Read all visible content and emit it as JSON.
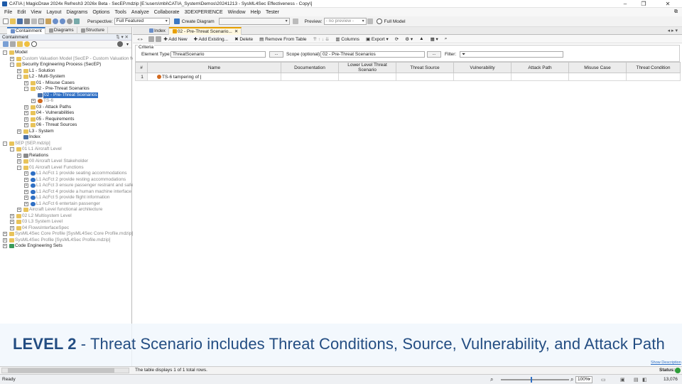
{
  "window": {
    "title": "CATIA | MagicDraw 2024x Refresh3 2026x Beta - SecEP.mdzip [E:\\users\\mbi\\CATIA_System\\Demos\\20241213 - SysML4Sec Effectiveness - Copy\\]"
  },
  "menu": [
    "File",
    "Edit",
    "View",
    "Layout",
    "Diagrams",
    "Options",
    "Tools",
    "Analyze",
    "Collaborate",
    "3DEXPERIENCE",
    "Window",
    "Help",
    "Tester"
  ],
  "toolbar": {
    "perspective_label": "Perspective:",
    "perspective_value": "Full Featured",
    "create_diagram": "Create Diagram",
    "preview_label": "Preview:",
    "preview_value": "- no preview -",
    "full_model": "Full Model"
  },
  "left_tabs": [
    "Containment",
    "Diagrams",
    "Structure"
  ],
  "containment_header": "Containment",
  "tree": [
    {
      "label": "Model",
      "indent": 0,
      "icon": "package",
      "toggle": "-"
    },
    {
      "label": "Custom Valuation Model [SecEP - Custom Valuation Mod",
      "indent": 1,
      "icon": "package",
      "toggle": "+",
      "gray": true
    },
    {
      "label": "Security Engineering Process (SecEP)",
      "indent": 1,
      "icon": "package",
      "toggle": "-"
    },
    {
      "label": "L1 - Solution",
      "indent": 2,
      "icon": "package",
      "toggle": "+"
    },
    {
      "label": "L2 - Multi-System",
      "indent": 2,
      "icon": "package",
      "toggle": "-"
    },
    {
      "label": "01 - Misuse Cases",
      "indent": 3,
      "icon": "package",
      "toggle": "+"
    },
    {
      "label": "02 - Pre-Threat Scenarios",
      "indent": 3,
      "icon": "package",
      "toggle": "-"
    },
    {
      "label": "02 - Pre-Threat Scenarios",
      "indent": 4,
      "icon": "table",
      "toggle": "",
      "selected": true
    },
    {
      "label": "TS-6",
      "indent": 4,
      "icon": "threat",
      "toggle": "+",
      "gray": true
    },
    {
      "label": "03 - Attack Paths",
      "indent": 3,
      "icon": "package",
      "toggle": "+"
    },
    {
      "label": "04 - Vulnerabilities",
      "indent": 3,
      "icon": "package",
      "toggle": "+"
    },
    {
      "label": "05 - Requirements",
      "indent": 3,
      "icon": "package",
      "toggle": "+"
    },
    {
      "label": "06 - Threat Sources",
      "indent": 3,
      "icon": "package",
      "toggle": "+"
    },
    {
      "label": "L3 - System",
      "indent": 2,
      "icon": "package",
      "toggle": "+"
    },
    {
      "label": "Index",
      "indent": 2,
      "icon": "table",
      "toggle": ""
    },
    {
      "label": "SEP [SEP.mdzip]",
      "indent": 0,
      "icon": "package",
      "toggle": "-",
      "gray": true
    },
    {
      "label": "01 L1 Aircraft Level",
      "indent": 1,
      "icon": "package",
      "toggle": "-",
      "gray": true
    },
    {
      "label": "Relations",
      "indent": 2,
      "icon": "relation",
      "toggle": "+"
    },
    {
      "label": "00 Aircraft Level Stakeholder",
      "indent": 2,
      "icon": "package",
      "toggle": "+",
      "gray": true
    },
    {
      "label": "01 Aircraft Level Functions",
      "indent": 2,
      "icon": "package",
      "toggle": "-",
      "gray": true
    },
    {
      "label": "L1 AcFct 1 provide seating accommodations",
      "indent": 3,
      "icon": "function",
      "toggle": "+",
      "gray": true
    },
    {
      "label": "L1 AcFct 2 provide resting accommodations",
      "indent": 3,
      "icon": "function",
      "toggle": "+",
      "gray": true
    },
    {
      "label": "L1 AcFct 3 ensure passenger restraint and safety",
      "indent": 3,
      "icon": "function",
      "toggle": "+",
      "gray": true
    },
    {
      "label": "L1 AcFct 4 provide a human machine interface",
      "indent": 3,
      "icon": "function",
      "toggle": "+",
      "gray": true
    },
    {
      "label": "L1 AcFct 5 provide flight information",
      "indent": 3,
      "icon": "function",
      "toggle": "+",
      "gray": true
    },
    {
      "label": "L1 AcFct 6 entertain passenger",
      "indent": 3,
      "icon": "function",
      "toggle": "+",
      "gray": true
    },
    {
      "label": "Aircraft Level functional architecture",
      "indent": 2,
      "icon": "package",
      "toggle": "+",
      "gray": true
    },
    {
      "label": "02 L2 Multisystem Level",
      "indent": 1,
      "icon": "package",
      "toggle": "+",
      "gray": true
    },
    {
      "label": "03 L3 System Level",
      "indent": 1,
      "icon": "package",
      "toggle": "+",
      "gray": true
    },
    {
      "label": "04 FlowsInterfaceSpec",
      "indent": 1,
      "icon": "package",
      "toggle": "+",
      "gray": true
    },
    {
      "label": "SysML4Sec Core Profile [SysML4Sec Core Profile.mdzip]",
      "indent": 0,
      "icon": "package",
      "toggle": "+",
      "gray": true
    },
    {
      "label": "SysML4Sec Profile [SysML4Sec Profile.mdzip]",
      "indent": 0,
      "icon": "package",
      "toggle": "+",
      "gray": true
    },
    {
      "label": "Code Engineering Sets",
      "indent": 0,
      "icon": "code",
      "toggle": "+"
    }
  ],
  "content_tabs": [
    "Index",
    "02 - Pre-Threat Scenario..."
  ],
  "table_toolbar": [
    "Add New",
    "Add Existing...",
    "Delete",
    "Remove From Table",
    "Columns",
    "Export"
  ],
  "criteria": {
    "legend": "Criteria",
    "element_type_label": "Element Type:",
    "element_type_value": "ThreatScenario",
    "scope_label": "Scope (optional):",
    "scope_value": "02 - Pre-Threat Scenarios",
    "filter_label": "Filter:",
    "filter_value": "",
    "browse": "..."
  },
  "columns": [
    "#",
    "Name",
    "Documentation",
    "Lower Level Threat Scenario",
    "Threat Source",
    "Vulnerability",
    "Attack Path",
    "Misuse Case",
    "Threat Condition"
  ],
  "rows": [
    {
      "num": "1",
      "name": "TS-6 tampering of"
    }
  ],
  "banner": {
    "lead": "LEVEL 2",
    "rest": " - Threat Scenario includes Threat Conditions, Source, Vulnerability, and Attack Path"
  },
  "table_status": "The table displays 1 of 1 total rows.",
  "show_description": "Show Description",
  "status_label": "Status:",
  "statusbar": {
    "ready": "Ready",
    "zoom": "100%",
    "memory": "13,076"
  },
  "colors": {
    "accent": "#2f6fc4",
    "banner_text": "#234d82",
    "tab_highlight": "#e8a000"
  }
}
